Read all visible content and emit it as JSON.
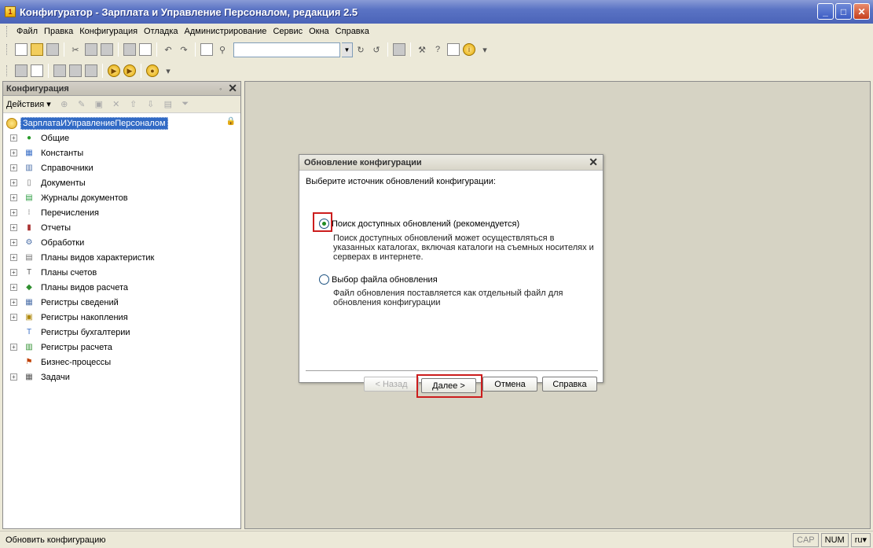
{
  "window": {
    "title": "Конфигуратор - Зарплата и Управление Персоналом, редакция 2.5",
    "controls": [
      "minimize-icon",
      "maximize-icon",
      "close-icon"
    ]
  },
  "menu": [
    "Файл",
    "Правка",
    "Конфигурация",
    "Отладка",
    "Администрирование",
    "Сервис",
    "Окна",
    "Справка"
  ],
  "panel": {
    "title": "Конфигурация",
    "actions_label": "Действия",
    "root": "ЗарплатаИУправлениеПерсоналом",
    "items": [
      {
        "label": "Общие",
        "icon": "common-icon",
        "expandable": true
      },
      {
        "label": "Константы",
        "icon": "constants-icon",
        "expandable": true
      },
      {
        "label": "Справочники",
        "icon": "catalogs-icon",
        "expandable": true
      },
      {
        "label": "Документы",
        "icon": "documents-icon",
        "expandable": true
      },
      {
        "label": "Журналы документов",
        "icon": "journals-icon",
        "expandable": true
      },
      {
        "label": "Перечисления",
        "icon": "enums-icon",
        "expandable": true
      },
      {
        "label": "Отчеты",
        "icon": "reports-icon",
        "expandable": true
      },
      {
        "label": "Обработки",
        "icon": "processing-icon",
        "expandable": true
      },
      {
        "label": "Планы видов характеристик",
        "icon": "characteristics-icon",
        "expandable": true
      },
      {
        "label": "Планы счетов",
        "icon": "accounts-chart-icon",
        "expandable": true
      },
      {
        "label": "Планы видов расчета",
        "icon": "calc-types-icon",
        "expandable": true
      },
      {
        "label": "Регистры сведений",
        "icon": "info-registers-icon",
        "expandable": true
      },
      {
        "label": "Регистры накопления",
        "icon": "accum-registers-icon",
        "expandable": true
      },
      {
        "label": "Регистры бухгалтерии",
        "icon": "accounting-registers-icon",
        "expandable": false
      },
      {
        "label": "Регистры расчета",
        "icon": "calc-registers-icon",
        "expandable": true
      },
      {
        "label": "Бизнес-процессы",
        "icon": "business-process-icon",
        "expandable": false
      },
      {
        "label": "Задачи",
        "icon": "tasks-icon",
        "expandable": true
      }
    ]
  },
  "dialog": {
    "title": "Обновление конфигурации",
    "prompt": "Выберите источник обновлений конфигурации:",
    "option1": {
      "label": "Поиск доступных обновлений (рекомендуется)",
      "desc1": "Поиск доступных обновлений может осуществляться в",
      "desc2": "указанных каталогах, включая каталоги на съемных носителях и",
      "desc3": "серверах в интернете.",
      "checked": true
    },
    "option2": {
      "label": "Выбор файла обновления",
      "desc1": "Файл обновления поставляется как отдельный файл для",
      "desc2": "обновления конфигурации",
      "checked": false
    },
    "buttons": {
      "back": "< Назад",
      "next": "Далее >",
      "cancel": "Отмена",
      "help": "Справка"
    }
  },
  "status": {
    "text": "Обновить конфигурацию",
    "cap": "CAP",
    "num": "NUM",
    "lang": "ru"
  },
  "colors": {
    "highlight_red": "#cc1d1d",
    "selection": "#316ac5"
  }
}
